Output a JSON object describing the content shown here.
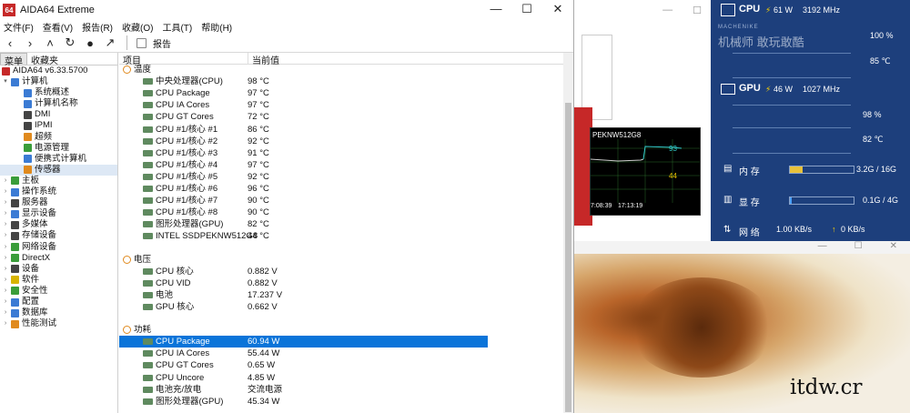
{
  "window": {
    "title": "AIDA64 Extreme",
    "logo_text": "64",
    "minimize": "—",
    "maximize": "☐",
    "close": "✕"
  },
  "menu": [
    "文件(F)",
    "查看(V)",
    "报告(R)",
    "收藏(O)",
    "工具(T)",
    "帮助(H)"
  ],
  "toolbar": {
    "report_label": "报告"
  },
  "left_tabs": [
    "菜单",
    "收藏夹"
  ],
  "tree": [
    {
      "label": "AIDA64 v6.33.5700",
      "level": 0,
      "icon": "aida-icon"
    },
    {
      "label": "计算机",
      "level": 0,
      "icon": "computer-icon",
      "expanded": true
    },
    {
      "label": "系统概述",
      "level": 1,
      "icon": "summary-icon"
    },
    {
      "label": "计算机名称",
      "level": 1,
      "icon": "name-icon"
    },
    {
      "label": "DMI",
      "level": 1,
      "icon": "dmi-icon"
    },
    {
      "label": "IPMI",
      "level": 1,
      "icon": "ipmi-icon"
    },
    {
      "label": "超频",
      "level": 1,
      "icon": "overclock-icon"
    },
    {
      "label": "电源管理",
      "level": 1,
      "icon": "power-icon"
    },
    {
      "label": "便携式计算机",
      "level": 1,
      "icon": "laptop-icon"
    },
    {
      "label": "传感器",
      "level": 1,
      "icon": "sensor-icon",
      "selected": true
    },
    {
      "label": "主板",
      "level": 0,
      "icon": "motherboard-icon"
    },
    {
      "label": "操作系统",
      "level": 0,
      "icon": "os-icon"
    },
    {
      "label": "服务器",
      "level": 0,
      "icon": "server-icon"
    },
    {
      "label": "显示设备",
      "level": 0,
      "icon": "display-icon"
    },
    {
      "label": "多媒体",
      "level": 0,
      "icon": "multimedia-icon"
    },
    {
      "label": "存储设备",
      "level": 0,
      "icon": "storage-icon"
    },
    {
      "label": "网络设备",
      "level": 0,
      "icon": "network-icon"
    },
    {
      "label": "DirectX",
      "level": 0,
      "icon": "directx-icon"
    },
    {
      "label": "设备",
      "level": 0,
      "icon": "devices-icon"
    },
    {
      "label": "软件",
      "level": 0,
      "icon": "software-icon"
    },
    {
      "label": "安全性",
      "level": 0,
      "icon": "security-icon"
    },
    {
      "label": "配置",
      "level": 0,
      "icon": "config-icon"
    },
    {
      "label": "数据库",
      "level": 0,
      "icon": "database-icon"
    },
    {
      "label": "性能测试",
      "level": 0,
      "icon": "benchmark-icon"
    }
  ],
  "columns": {
    "item": "项目",
    "value": "当前值"
  },
  "sections": [
    {
      "title": "温度",
      "rows": [
        {
          "name": "中央处理器(CPU)",
          "value": "98 °C"
        },
        {
          "name": "CPU Package",
          "value": "97 °C"
        },
        {
          "name": "CPU IA Cores",
          "value": "97 °C"
        },
        {
          "name": "CPU GT Cores",
          "value": "72 °C"
        },
        {
          "name": "CPU #1/核心 #1",
          "value": "86 °C"
        },
        {
          "name": "CPU #1/核心 #2",
          "value": "92 °C"
        },
        {
          "name": "CPU #1/核心 #3",
          "value": "91 °C"
        },
        {
          "name": "CPU #1/核心 #4",
          "value": "97 °C"
        },
        {
          "name": "CPU #1/核心 #5",
          "value": "92 °C"
        },
        {
          "name": "CPU #1/核心 #6",
          "value": "96 °C"
        },
        {
          "name": "CPU #1/核心 #7",
          "value": "90 °C"
        },
        {
          "name": "CPU #1/核心 #8",
          "value": "90 °C"
        },
        {
          "name": "图形处理器(GPU)",
          "value": "82 °C"
        },
        {
          "name": "INTEL SSDPEKNW512G8",
          "value": "44 °C"
        }
      ]
    },
    {
      "title": "电压",
      "rows": [
        {
          "name": "CPU 核心",
          "value": "0.882 V"
        },
        {
          "name": "CPU VID",
          "value": "0.882 V"
        },
        {
          "name": "电池",
          "value": "17.237 V"
        },
        {
          "name": "GPU 核心",
          "value": "0.662 V"
        }
      ]
    },
    {
      "title": "功耗",
      "rows": [
        {
          "name": "CPU Package",
          "value": "60.94 W",
          "selected": true
        },
        {
          "name": "CPU IA Cores",
          "value": "55.44 W"
        },
        {
          "name": "CPU GT Cores",
          "value": "0.65 W"
        },
        {
          "name": "CPU Uncore",
          "value": "4.85 W"
        },
        {
          "name": "电池充/放电",
          "value": "交流电源"
        },
        {
          "name": "图形处理器(GPU)",
          "value": "45.34 W"
        }
      ]
    }
  ],
  "monitor": {
    "cpu": {
      "label": "CPU",
      "power": "61 W",
      "clock": "3192 MHz",
      "usage": "100 %",
      "temp": "85 ℃"
    },
    "gpu": {
      "label": "GPU",
      "power": "46 W",
      "clock": "1027 MHz",
      "usage": "98 %",
      "temp": "82 ℃"
    },
    "memory": {
      "label": "内 存",
      "value": "3.2G / 16G",
      "fill": 0.2
    },
    "vram": {
      "label": "显 存",
      "value": "0.1G / 4G",
      "fill": 0.025
    },
    "net": {
      "label": "网 络",
      "down": "1.00 KB/s",
      "up": "0 KB/s"
    },
    "watermark_small": "MACHENIKE",
    "watermark": "机械师  敢玩敢酷"
  },
  "graph": {
    "device": "PEKNW512G8",
    "t1": "7:08:39",
    "t2": "17:13:19",
    "v1": "93",
    "v2": "44"
  },
  "site": "itdw.cr",
  "colors": {
    "accent": "#0a74d9",
    "monitor_bg": "#1d3f7c"
  }
}
